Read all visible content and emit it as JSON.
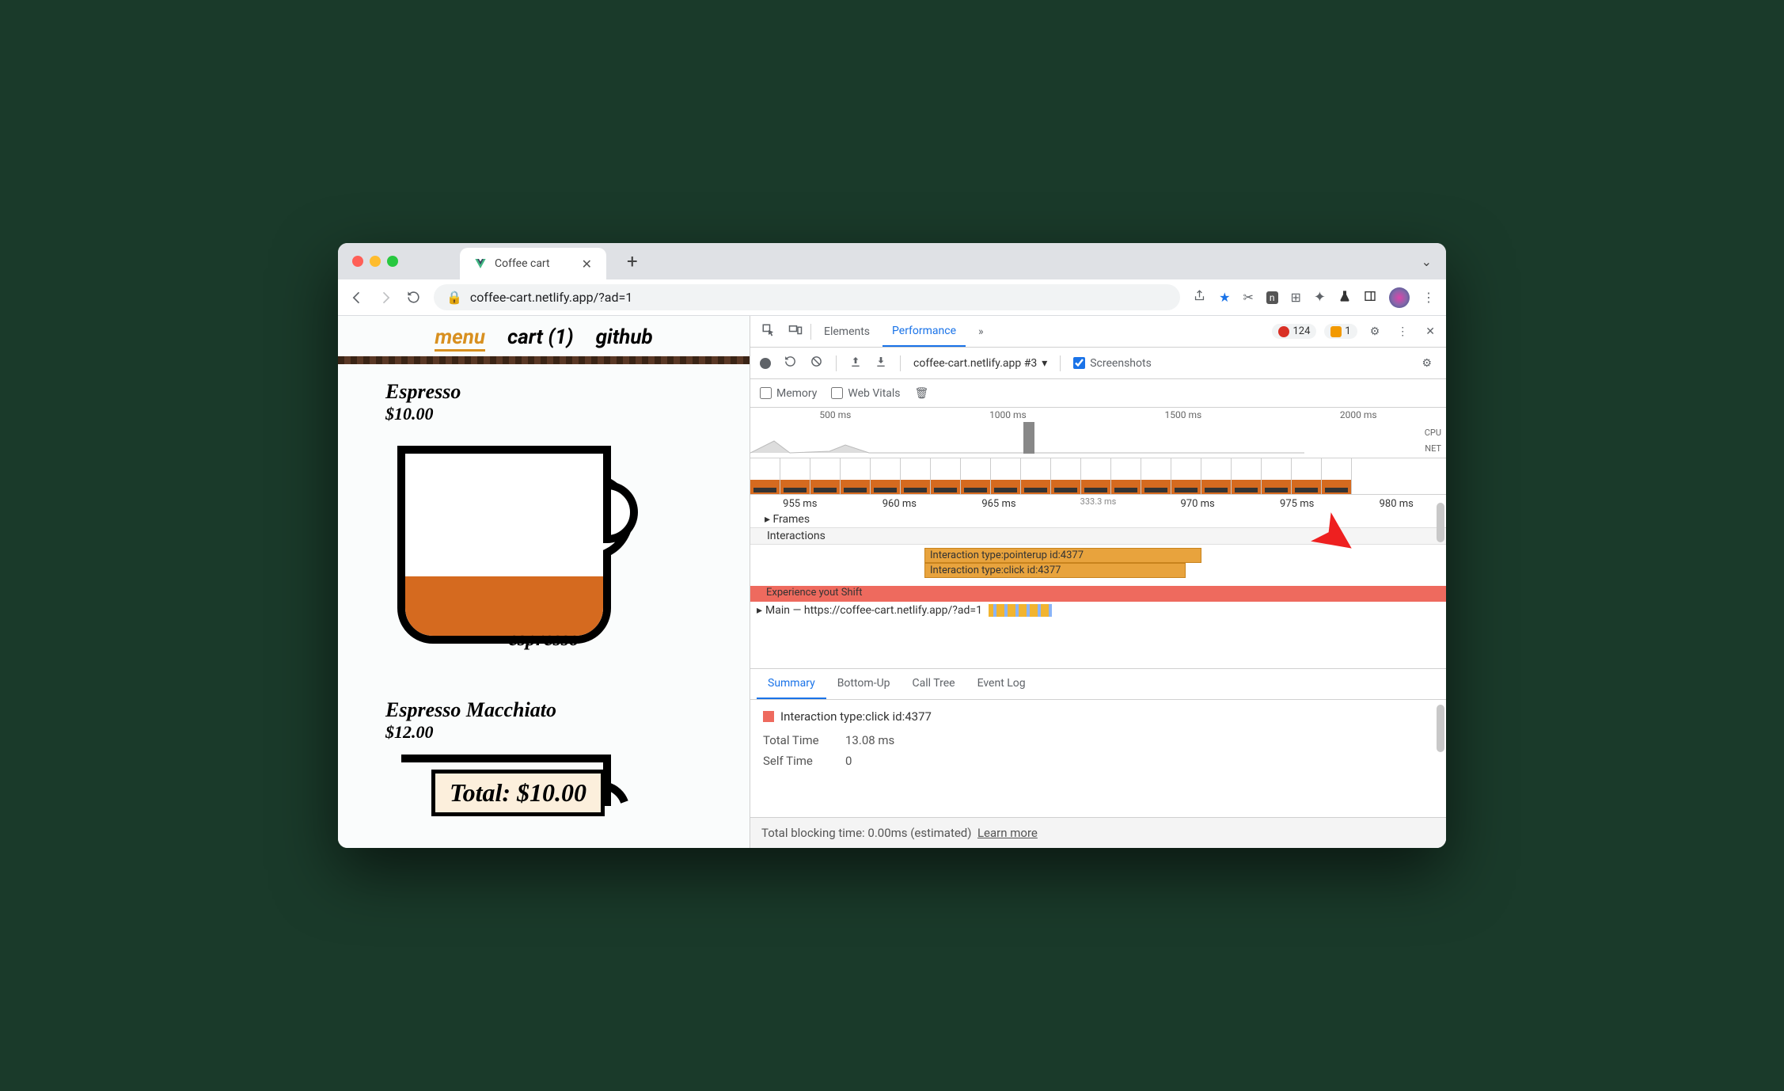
{
  "titlebar": {
    "tab_title": "Coffee cart"
  },
  "addressbar": {
    "url": "coffee-cart.netlify.app/?ad=1"
  },
  "page": {
    "nav": {
      "menu": "menu",
      "cart": "cart (1)",
      "github": "github"
    },
    "products": [
      {
        "name": "Espresso",
        "price": "$10.00",
        "fill": "espresso"
      },
      {
        "name": "Espresso Macchiato",
        "price": "$12.00"
      }
    ],
    "total": "Total: $10.00"
  },
  "devtools": {
    "tabs": {
      "elements": "Elements",
      "performance": "Performance",
      "more": "»"
    },
    "badges": {
      "errors": "124",
      "warnings": "1"
    },
    "toolbar": {
      "profile": "coffee-cart.netlify.app #3",
      "screenshots": "Screenshots"
    },
    "toolbar2": {
      "memory": "Memory",
      "webvitals": "Web Vitals"
    },
    "overview": {
      "ticks": [
        "500 ms",
        "1000 ms",
        "1500 ms",
        "2000 ms"
      ],
      "cpu": "CPU",
      "net": "NET"
    },
    "ruler": [
      "955 ms",
      "960 ms",
      "965 ms",
      "970 ms",
      "975 ms",
      "980 ms"
    ],
    "ruler_extra": "333.3 ms",
    "tracks": {
      "frames": "Frames",
      "interactions": "Interactions"
    },
    "bars": {
      "b1": "Interaction type:pointerup id:4377",
      "b2": "Interaction type:click id:4377"
    },
    "experience": "Experience   yout Shift",
    "main": "Main — https://coffee-cart.netlify.app/?ad=1",
    "sumtabs": {
      "summary": "Summary",
      "bottomup": "Bottom-Up",
      "calltree": "Call Tree",
      "eventlog": "Event Log"
    },
    "summary": {
      "title": "Interaction type:click id:4377",
      "rows": [
        {
          "lbl": "Total Time",
          "val": "13.08 ms"
        },
        {
          "lbl": "Self Time",
          "val": "0"
        }
      ]
    },
    "footer": {
      "blocking": "Total blocking time: 0.00ms (estimated)",
      "learn": "Learn more"
    }
  }
}
